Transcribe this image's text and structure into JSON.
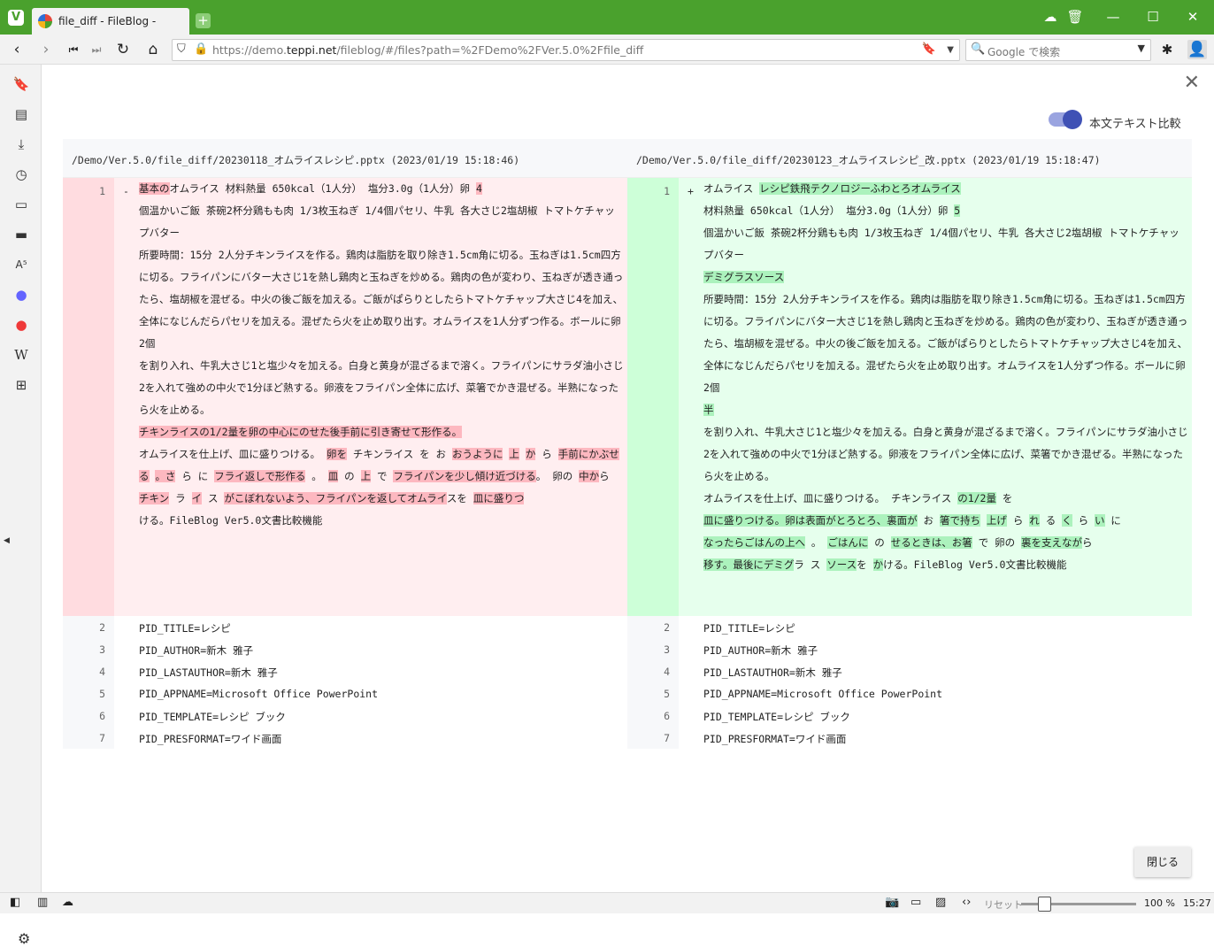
{
  "browser": {
    "tab_title": "file_diff - FileBlog -",
    "url_prefix": "https://demo.",
    "url_host": "teppi.net",
    "url_rest": "/fileblog/#/files?path=%2FDemo%2FVer.5.0%2Ffile_diff",
    "search_placeholder": "Google で検索"
  },
  "page": {
    "toggle_label": "本文テキスト比較",
    "close_button": "閉じる"
  },
  "diff": {
    "left": {
      "header": "/Demo/Ver.5.0/file_diff/20230118_オムライスレシピ.pptx (2023/01/19 15:18:46)",
      "line_no": "1",
      "marker": "-",
      "lines": [
        [
          {
            "t": "基本の",
            "h": true
          },
          {
            "t": "オムライス 材料熱量 650kcal（1人分） 塩分3.0g（1人分）卵 ",
            "h": false
          },
          {
            "t": "4",
            "h": true
          }
        ],
        [
          {
            "t": "個温かいご飯 茶碗2杯分鶏もも肉 1/3枚玉ねぎ 1/4個パセリ、牛乳 各大さじ2塩胡椒 トマトケチャップバター",
            "h": false
          }
        ],
        [
          {
            "t": "所要時間：15分 2人分チキンライスを作る。鶏肉は脂肪を取り除き1.5cm角に切る。玉ねぎは1.5cm四方に切る。フライパンにバター大さじ1を熱し鶏肉と玉ねぎを炒める。鶏肉の色が変わり、玉ねぎが透き通ったら、塩胡椒を混ぜる。中火の後ご飯を加える。ご飯がぱらりとしたらトマトケチャップ大さじ4を加え、全体になじんだらパセリを加える。混ぜたら火を止め取り出す。オムライスを1人分ずつ作る。ボールに卵2個",
            "h": false
          }
        ],
        [
          {
            "t": "を割り入れ、牛乳大さじ1と塩少々を加える。白身と黄身が混ざるまで溶く。フライパンにサラダ油小さじ2を入れて強めの中火で1分ほど熱する。卵液をフライパン全体に広げ、菜箸でかき混ぜる。半熟になったら火を止める。",
            "h": false
          }
        ],
        [
          {
            "t": "チキンライスの1/2量を卵の中心にのせた後手前に引き寄せて形作る。",
            "h": true
          }
        ],
        [
          {
            "t": "オムライスを仕上げ、皿に盛りつける。 ",
            "h": false
          },
          {
            "t": "卵を",
            "h": true
          },
          {
            "t": " チキンライス を お ",
            "h": false
          },
          {
            "t": "おうように",
            "h": true
          },
          {
            "t": " ",
            "h": false
          },
          {
            "t": "上",
            "h": true
          },
          {
            "t": " ",
            "h": false
          },
          {
            "t": "か",
            "h": true
          },
          {
            "t": " ら ",
            "h": false
          },
          {
            "t": "手前にかぶせる",
            "h": true
          },
          {
            "t": " ",
            "h": false
          },
          {
            "t": "。さ",
            "h": true
          },
          {
            "t": " ら に ",
            "h": false
          },
          {
            "t": "フライ返しで形作る",
            "h": true
          },
          {
            "t": " 。 ",
            "h": false
          },
          {
            "t": "皿",
            "h": true
          },
          {
            "t": " の ",
            "h": false
          },
          {
            "t": "上",
            "h": true
          },
          {
            "t": " で ",
            "h": false
          },
          {
            "t": "フライパンを少し傾け近づける",
            "h": true
          },
          {
            "t": "。 卵の ",
            "h": false
          },
          {
            "t": "中か",
            "h": true
          },
          {
            "t": "ら ",
            "h": false
          },
          {
            "t": "チキン",
            "h": true
          },
          {
            "t": " ラ ",
            "h": false
          },
          {
            "t": "イ",
            "h": true
          },
          {
            "t": " ス ",
            "h": false
          },
          {
            "t": "がこぼれないよう、フライパンを返してオムライ",
            "h": true
          },
          {
            "t": "スを ",
            "h": false
          },
          {
            "t": "皿に盛りつ",
            "h": true
          }
        ],
        [
          {
            "t": "ける。FileBlog Ver5.0文書比較機能",
            "h": false
          }
        ]
      ]
    },
    "right": {
      "header": "/Demo/Ver.5.0/file_diff/20230123_オムライスレシピ_改.pptx (2023/01/19 15:18:47)",
      "line_no": "1",
      "marker": "+",
      "lines": [
        [
          {
            "t": "オムライス ",
            "h": false
          },
          {
            "t": "レシピ鉄飛テクノロジーふわとろオムライス",
            "h": true
          }
        ],
        [
          {
            "t": "材料熱量 650kcal（1人分） 塩分3.0g（1人分）卵 ",
            "h": false
          },
          {
            "t": "5",
            "h": true
          }
        ],
        [
          {
            "t": "個温かいご飯 茶碗2杯分鶏もも肉 1/3枚玉ねぎ 1/4個パセリ、牛乳 各大さじ2塩胡椒 トマトケチャップバター",
            "h": false
          }
        ],
        [
          {
            "t": " デミグラスソース",
            "h": true
          }
        ],
        [
          {
            "t": "所要時間：15分 2人分チキンライスを作る。鶏肉は脂肪を取り除き1.5cm角に切る。玉ねぎは1.5cm四方に切る。フライパンにバター大さじ1を熱し鶏肉と玉ねぎを炒める。鶏肉の色が変わり、玉ねぎが透き通ったら、塩胡椒を混ぜる。中火の後ご飯を加える。ご飯がぱらりとしたらトマトケチャップ大さじ4を加え、全体になじんだらパセリを加える。混ぜたら火を止め取り出す。オムライスを1人分ずつ作る。ボールに卵2個",
            "h": false
          }
        ],
        [
          {
            "t": "半",
            "h": true
          }
        ],
        [
          {
            "t": "を割り入れ、牛乳大さじ1と塩少々を加える。白身と黄身が混ざるまで溶く。フライパンにサラダ油小さじ2を入れて強めの中火で1分ほど熱する。卵液をフライパン全体に広げ、菜箸でかき混ぜる。半熟になったら火を止める。",
            "h": false
          }
        ],
        [
          {
            "t": "オムライスを仕上げ、皿に盛りつける。 チキンライス ",
            "h": false
          },
          {
            "t": "の1/2量",
            "h": true
          },
          {
            "t": " を",
            "h": false
          }
        ],
        [
          {
            "t": "皿に盛りつける。卵は表面がとろとろ、裏面が",
            "h": true
          },
          {
            "t": " お ",
            "h": false
          },
          {
            "t": "箸で持ち",
            "h": true
          },
          {
            "t": " ",
            "h": false
          },
          {
            "t": "上げ",
            "h": true
          },
          {
            "t": " ら ",
            "h": false
          },
          {
            "t": "れ",
            "h": true
          },
          {
            "t": " る ",
            "h": false
          },
          {
            "t": "く",
            "h": true
          },
          {
            "t": " ら ",
            "h": false
          },
          {
            "t": "い",
            "h": true
          },
          {
            "t": " に",
            "h": false
          }
        ],
        [
          {
            "t": "なったらごはんの上へ",
            "h": true
          },
          {
            "t": " 。 ",
            "h": false
          },
          {
            "t": "ごはんに",
            "h": true
          },
          {
            "t": " の ",
            "h": false
          },
          {
            "t": "せるときは、お箸",
            "h": true
          },
          {
            "t": " で 卵の ",
            "h": false
          },
          {
            "t": "裏を支えなが",
            "h": true
          },
          {
            "t": "ら",
            "h": false
          }
        ],
        [
          {
            "t": "移す。最後にデミグ",
            "h": true
          },
          {
            "t": "ラ ス ",
            "h": false
          },
          {
            "t": "ソース",
            "h": true
          },
          {
            "t": "を ",
            "h": false
          },
          {
            "t": "か",
            "h": true
          },
          {
            "t": "ける。FileBlog Ver5.0文書比較機能",
            "h": false
          }
        ]
      ]
    },
    "context": [
      {
        "n": "2",
        "t": "PID_TITLE=レシピ"
      },
      {
        "n": "3",
        "t": "PID_AUTHOR=新木 雅子"
      },
      {
        "n": "4",
        "t": "PID_LASTAUTHOR=新木 雅子"
      },
      {
        "n": "5",
        "t": "PID_APPNAME=Microsoft Office PowerPoint"
      },
      {
        "n": "6",
        "t": "PID_TEMPLATE=レシピ ブック"
      },
      {
        "n": "7",
        "t": "PID_PRESFORMAT=ワイド画面"
      }
    ]
  },
  "statusbar": {
    "reset": "リセット",
    "zoom": "100 %",
    "time": "15:27"
  }
}
